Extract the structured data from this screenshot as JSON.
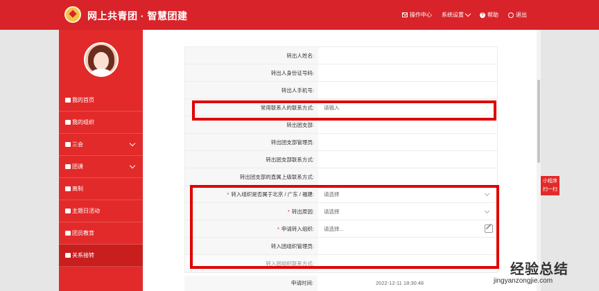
{
  "header": {
    "brand": "网上共青团 · 智慧团建",
    "nav": [
      "操作中心",
      "系统设置",
      "帮助",
      "退出"
    ]
  },
  "sidebar": {
    "items": [
      {
        "label": "我的首页",
        "chevron": false,
        "active": false
      },
      {
        "label": "我的组织",
        "chevron": false,
        "active": false
      },
      {
        "label": "三会",
        "chevron": true,
        "active": false
      },
      {
        "label": "团课",
        "chevron": true,
        "active": false
      },
      {
        "label": "离制",
        "chevron": false,
        "active": false
      },
      {
        "label": "主题日活动",
        "chevron": false,
        "active": false
      },
      {
        "label": "团员教育",
        "chevron": false,
        "active": false
      },
      {
        "label": "关系接转",
        "chevron": false,
        "active": true
      }
    ]
  },
  "form": {
    "rows": [
      {
        "label": "转出人姓名:",
        "value": "",
        "required": false,
        "type": "text"
      },
      {
        "label": "转出人身份证号码:",
        "value": "",
        "required": false,
        "type": "text"
      },
      {
        "label": "转出人手机号:",
        "value": "",
        "required": false,
        "type": "text"
      },
      {
        "label": "常用联系人的联系方式:",
        "value": "请输入",
        "required": false,
        "type": "input"
      },
      {
        "label": "转出团支部:",
        "value": "",
        "required": false,
        "type": "text"
      },
      {
        "label": "转出团支部管理员:",
        "value": "",
        "required": false,
        "type": "text"
      },
      {
        "label": "转出团支部联系方式:",
        "value": "",
        "required": false,
        "type": "text"
      },
      {
        "label": "转出团支部的直属上级联系方式:",
        "value": "",
        "required": false,
        "type": "text"
      },
      {
        "label": "转入组织是否属于北京 / 广东 / 福建:",
        "value": "请选择",
        "required": true,
        "type": "select"
      },
      {
        "label": "转出原因:",
        "value": "请选择",
        "required": true,
        "type": "select"
      },
      {
        "label": "申请转入组织:",
        "value": "请选择...",
        "required": true,
        "type": "picker"
      },
      {
        "label": "转入团组织管理员:",
        "value": "",
        "required": false,
        "type": "text"
      },
      {
        "label": "转入团组织联系方式:",
        "value": "",
        "required": false,
        "type": "text"
      }
    ],
    "submit_time_label": "申请时间:",
    "submit_time": "2022-12-11 18:30:48"
  },
  "side_tab": [
    "小程序",
    "扫一扫"
  ],
  "watermark": {
    "title": "经验总结",
    "url": "jingyanzongjie.com"
  },
  "colors": {
    "brand_red": "#d8232a",
    "highlight_red": "#e00000"
  }
}
